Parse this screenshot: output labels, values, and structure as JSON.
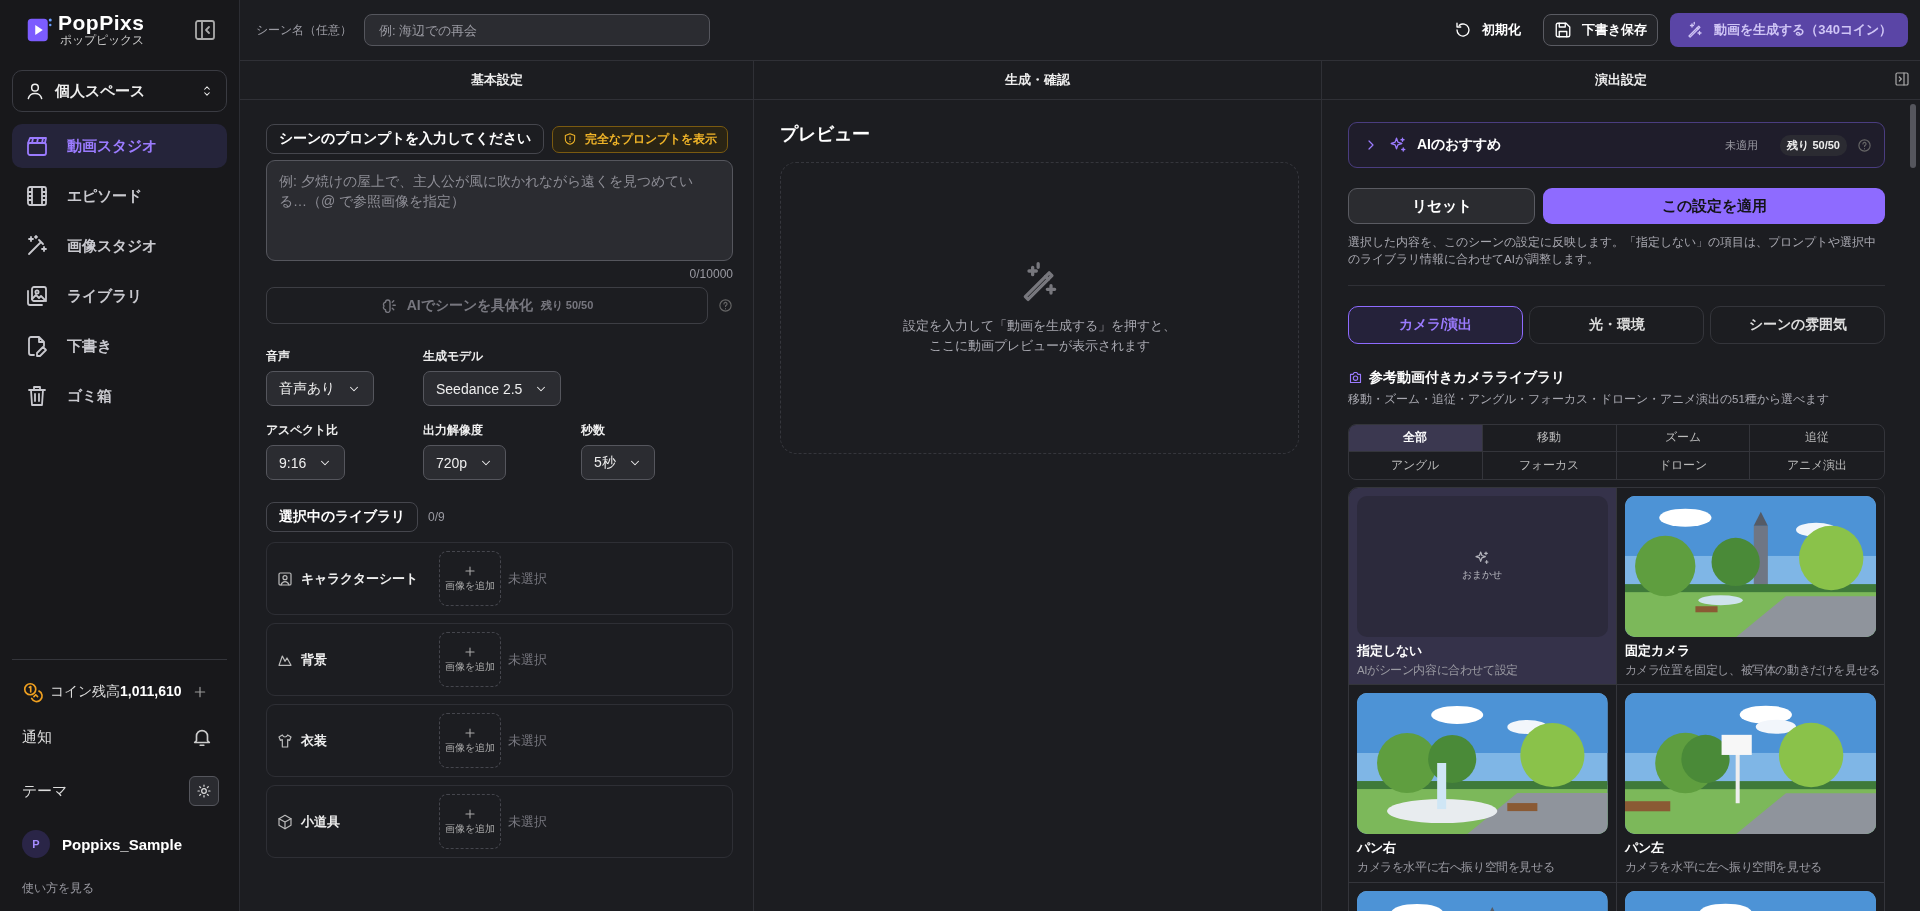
{
  "sidebar": {
    "brand": {
      "name": "PopPixs",
      "tagline": "ポップピックス"
    },
    "workspace": "個人スペース",
    "nav": [
      {
        "label": "動画スタジオ",
        "selected": true
      },
      {
        "label": "エピソード",
        "selected": false
      },
      {
        "label": "画像スタジオ",
        "selected": false
      },
      {
        "label": "ライブラリ",
        "selected": false
      },
      {
        "label": "下書き",
        "selected": false
      },
      {
        "label": "ゴミ箱",
        "selected": false
      }
    ],
    "coins": "コイン残高**1,011,610**",
    "notifications": "通知",
    "theme": "テーマ",
    "user": {
      "initial": "P",
      "name": "Poppixs_Sample"
    },
    "help_link": "使い方を見る"
  },
  "topbar": {
    "scene_name": {
      "label": "シーン名（任意）",
      "placeholder": "例: 海辺での再会"
    },
    "buttons": [
      {
        "kind": "plain",
        "label": "初期化"
      },
      {
        "kind": "outline",
        "label": "下書き保存"
      },
      {
        "kind": "primary",
        "label": "動画を生成する（340コイン）"
      }
    ]
  },
  "columns": [
    "基本設定",
    "生成・確認",
    "演出設定"
  ],
  "basic": {
    "prompt_label": "シーンのプロンプトを入力してください",
    "full_prompt_button": "完全なプロンプトを表示",
    "prompt_placeholder": "例: 夕焼けの屋上で、主人公が風に吹かれながら遠くを見つめている…（@ で参照画像を指定）",
    "counter": "0/10000",
    "ai_button": {
      "label": "AIでシーンを具体化",
      "remaining": "残り 50/50",
      "disabled": true
    },
    "settings_rows": [
      [
        {
          "label": "音声",
          "value": "音声あり"
        },
        {
          "label": "生成モデル",
          "value": "Seedance 2.5"
        }
      ],
      [
        {
          "label": "アスペクト比",
          "value": "9:16"
        },
        {
          "label": "出力解像度",
          "value": "720p"
        },
        {
          "label": "秒数",
          "value": "5秒"
        }
      ]
    ],
    "library": {
      "title": "選択中のライブラリ",
      "count": "0/9",
      "slots": [
        {
          "label": "キャラクターシート",
          "add": "画像を追加",
          "status": "未選択"
        },
        {
          "label": "背景",
          "add": "画像を追加",
          "status": "未選択"
        },
        {
          "label": "衣装",
          "add": "画像を追加",
          "status": "未選択"
        },
        {
          "label": "小道具",
          "add": "画像を追加",
          "status": "未選択"
        }
      ]
    }
  },
  "preview": {
    "title": "プレビュー",
    "message_lines": [
      "設定を入力して「動画を生成する」を押すと、",
      "ここに動画プレビューが表示されます"
    ]
  },
  "direction": {
    "ai_recommend": {
      "title": "AIのおすすめ",
      "status": "未適用",
      "remaining": "残り 50/50",
      "expanded": false
    },
    "reset_button": "リセット",
    "apply_button": "この設定を適用",
    "note": "選択した内容を、このシーンの設定に反映します。「指定しない」の項目は、プロンプトや選択中のライブラリ情報に合わせてAIが調整します。",
    "tabs": [
      {
        "label": "カメラ/演出",
        "selected": true
      },
      {
        "label": "光・環境",
        "selected": false
      },
      {
        "label": "シーンの雰囲気",
        "selected": false
      }
    ],
    "camera_library": {
      "title": "参考動画付きカメラライブラリ",
      "subtitle": "移動・ズーム・追従・アングル・フォーカス・ドローン・アニメ演出の51種から選べます",
      "filters": [
        {
          "label": "全部",
          "selected": true
        },
        {
          "label": "移動",
          "selected": false
        },
        {
          "label": "ズーム",
          "selected": false
        },
        {
          "label": "追従",
          "selected": false
        },
        {
          "label": "アングル",
          "selected": false
        },
        {
          "label": "フォーカス",
          "selected": false
        },
        {
          "label": "ドローン",
          "selected": false
        },
        {
          "label": "アニメ演出",
          "selected": false
        }
      ],
      "cards": [
        {
          "kind": "auto",
          "thumb_label": "おまかせ",
          "title": "指定しない",
          "desc": "AIがシーン内容に合わせて設定",
          "selected": true
        },
        {
          "kind": "picture",
          "title": "固定カメラ",
          "desc": "カメラ位置を固定し、被写体の動きだけを見せる",
          "selected": false
        },
        {
          "kind": "picture",
          "title": "パン右",
          "desc": "カメラを水平に右へ振り空間を見せる",
          "selected": false
        },
        {
          "kind": "picture",
          "title": "パン左",
          "desc": "カメラを水平に左へ振り空間を見せる",
          "selected": false
        },
        {
          "kind": "picture",
          "selected": false
        },
        {
          "kind": "picture",
          "selected": false
        }
      ]
    }
  }
}
